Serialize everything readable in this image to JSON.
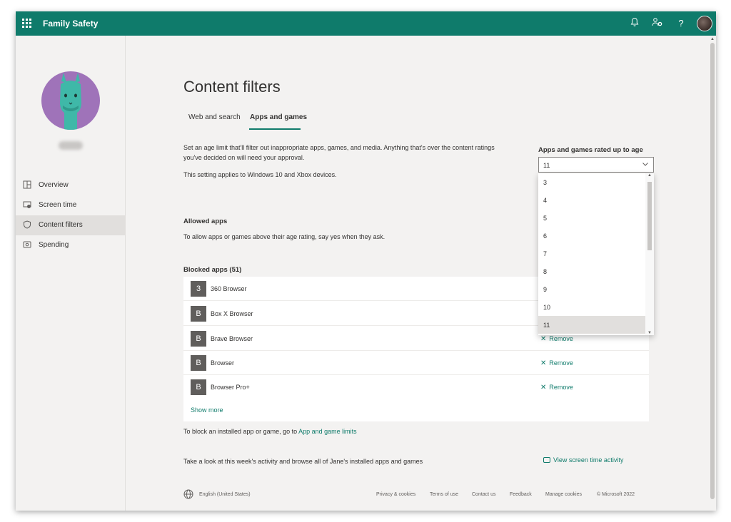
{
  "app": {
    "title": "Family Safety"
  },
  "topbar": {
    "icons": [
      "bell-icon",
      "people-settings-icon",
      "help-icon",
      "profile-avatar"
    ],
    "help_glyph": "?"
  },
  "sidebar": {
    "items": [
      {
        "label": "Overview",
        "icon": "overview-icon"
      },
      {
        "label": "Screen time",
        "icon": "screen-time-icon"
      },
      {
        "label": "Content filters",
        "icon": "shield-icon",
        "active": true
      },
      {
        "label": "Spending",
        "icon": "spending-icon"
      }
    ]
  },
  "page": {
    "title": "Content filters",
    "tabs": [
      {
        "label": "Web and search"
      },
      {
        "label": "Apps and games",
        "selected": true
      }
    ],
    "description": "Set an age limit that'll filter out inappropriate apps, games, and media. Anything that's over the content ratings you've decided on will need your approval.",
    "devices_note": "This setting applies to Windows 10 and Xbox devices."
  },
  "age_filter": {
    "label": "Apps and games rated up to age",
    "selected_value": "11",
    "options": [
      "3",
      "4",
      "5",
      "6",
      "7",
      "8",
      "9",
      "10",
      "11"
    ]
  },
  "allowed": {
    "title": "Allowed apps",
    "text": "To allow apps or games above their age rating, say yes when they ask."
  },
  "blocked": {
    "title": "Blocked apps (51)",
    "remove_label": "Remove",
    "apps": [
      {
        "initial": "3",
        "name": "360 Browser"
      },
      {
        "initial": "B",
        "name": "Box X Browser"
      },
      {
        "initial": "B",
        "name": "Brave Browser"
      },
      {
        "initial": "B",
        "name": "Browser"
      },
      {
        "initial": "B",
        "name": "Browser Pro+"
      }
    ],
    "show_more": "Show more"
  },
  "bottom": {
    "block_prefix": "To block an installed app or game, go to ",
    "block_link": "App and game limits",
    "activity_text": "Take a look at this week's activity and browse all of Jane's installed apps and games",
    "activity_link": "View screen time activity"
  },
  "footer": {
    "language": "English (United States)",
    "links": [
      "Privacy & cookies",
      "Terms of use",
      "Contact us",
      "Feedback",
      "Manage cookies",
      "© Microsoft 2022"
    ]
  },
  "colors": {
    "brand": "#0f7b6b",
    "profile_bg": "#9f73b9",
    "llama": "#3fb8a8"
  }
}
